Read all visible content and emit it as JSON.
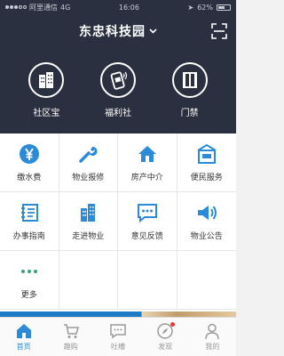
{
  "status_bar": {
    "carrier": "阿里通信",
    "network": "4G",
    "time": "16:06",
    "battery": "62%",
    "battery_level": 0.62
  },
  "header": {
    "title": "东忠科技园"
  },
  "top_features": [
    {
      "label": "社区宝",
      "icon": "building-icon"
    },
    {
      "label": "福利社",
      "icon": "phone-gift-icon"
    },
    {
      "label": "门禁",
      "icon": "door-icon"
    }
  ],
  "services": [
    {
      "label": "缴水费",
      "icon": "yen-icon"
    },
    {
      "label": "物业报修",
      "icon": "wrench-icon"
    },
    {
      "label": "房产中介",
      "icon": "house-icon"
    },
    {
      "label": "便民服务",
      "icon": "store-icon"
    },
    {
      "label": "办事指南",
      "icon": "guide-icon"
    },
    {
      "label": "走进物业",
      "icon": "building-icon"
    },
    {
      "label": "意见反馈",
      "icon": "chat-icon"
    },
    {
      "label": "物业公告",
      "icon": "speaker-icon"
    },
    {
      "label": "更多",
      "icon": "more-icon"
    }
  ],
  "tabbar": [
    {
      "label": "首页",
      "icon": "home-icon",
      "active": true
    },
    {
      "label": "趣购",
      "icon": "cart-icon",
      "active": false
    },
    {
      "label": "吐槽",
      "icon": "comment-icon",
      "active": false
    },
    {
      "label": "发现",
      "icon": "compass-icon",
      "active": false
    },
    {
      "label": "我的",
      "icon": "user-icon",
      "active": false
    }
  ],
  "colors": {
    "header_bg": "#2b3040",
    "accent_blue": "#2c8ad6",
    "badge_red": "#e53935"
  }
}
